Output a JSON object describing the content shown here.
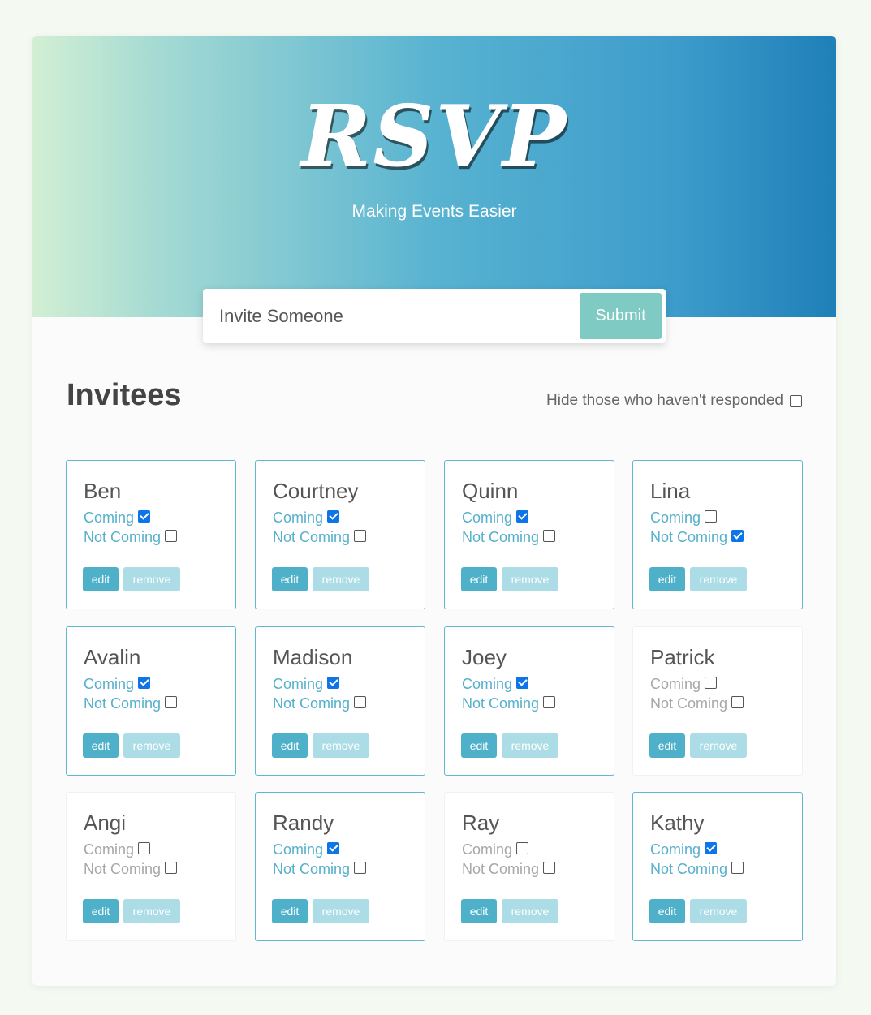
{
  "header": {
    "logo": "RSVP",
    "tagline": "Making Events Easier"
  },
  "invite": {
    "placeholder": "Invite Someone",
    "submit_label": "Submit"
  },
  "section": {
    "title": "Invitees",
    "filter_label": "Hide those who haven't responded",
    "filter_checked": false
  },
  "labels": {
    "coming": "Coming",
    "not_coming": "Not Coming",
    "edit": "edit",
    "remove": "remove"
  },
  "invitees": [
    {
      "name": "Ben",
      "coming": true,
      "not_coming": false
    },
    {
      "name": "Courtney",
      "coming": true,
      "not_coming": false
    },
    {
      "name": "Quinn",
      "coming": true,
      "not_coming": false
    },
    {
      "name": "Lina",
      "coming": false,
      "not_coming": true
    },
    {
      "name": "Avalin",
      "coming": true,
      "not_coming": false
    },
    {
      "name": "Madison",
      "coming": true,
      "not_coming": false
    },
    {
      "name": "Joey",
      "coming": true,
      "not_coming": false
    },
    {
      "name": "Patrick",
      "coming": false,
      "not_coming": false
    },
    {
      "name": "Angi",
      "coming": false,
      "not_coming": false
    },
    {
      "name": "Randy",
      "coming": true,
      "not_coming": false
    },
    {
      "name": "Ray",
      "coming": false,
      "not_coming": false
    },
    {
      "name": "Kathy",
      "coming": true,
      "not_coming": false
    }
  ]
}
